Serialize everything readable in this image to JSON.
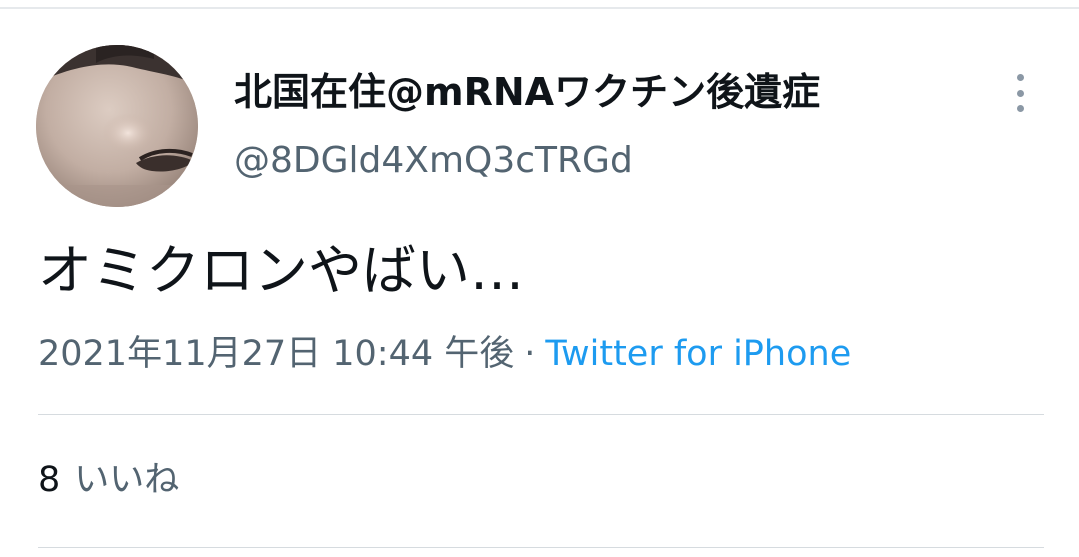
{
  "tweet": {
    "author": {
      "display_name": "北国在住@mRNAワクチン後遺症",
      "handle": "@8DGld4XmQ3cTRGd",
      "avatar": "profile-photo"
    },
    "text": "オミクロンやばい…",
    "timestamp": "2021年11月27日 10:44 午後",
    "separator": "·",
    "source": "Twitter for iPhone",
    "likes": {
      "count": "8",
      "label": "いいね"
    }
  },
  "colors": {
    "text_primary": "#0f1419",
    "text_secondary": "#536471",
    "link": "#1d9bf0",
    "divider": "#d6dbdf",
    "more_dots": "#8b98a5"
  },
  "icons": {
    "more": "more-vertical-icon"
  }
}
